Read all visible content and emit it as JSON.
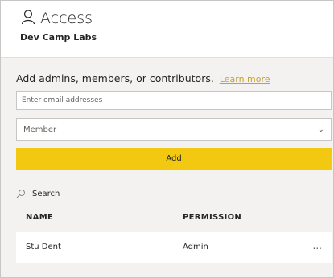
{
  "header": {
    "title": "Access",
    "workspace": "Dev Camp Labs"
  },
  "add_section": {
    "instruction": "Add admins, members, or contributors.",
    "learn_more": "Learn more",
    "email_placeholder": "Enter email addresses",
    "role_selected": "Member",
    "add_label": "Add"
  },
  "search": {
    "placeholder": "Search"
  },
  "table": {
    "headers": {
      "name": "NAME",
      "permission": "PERMISSION"
    },
    "rows": [
      {
        "name": "Stu Dent",
        "permission": "Admin",
        "more": "..."
      }
    ]
  },
  "colors": {
    "accent": "#f2c811",
    "link": "#c9a227",
    "panel_bg": "#f3f2f1"
  }
}
